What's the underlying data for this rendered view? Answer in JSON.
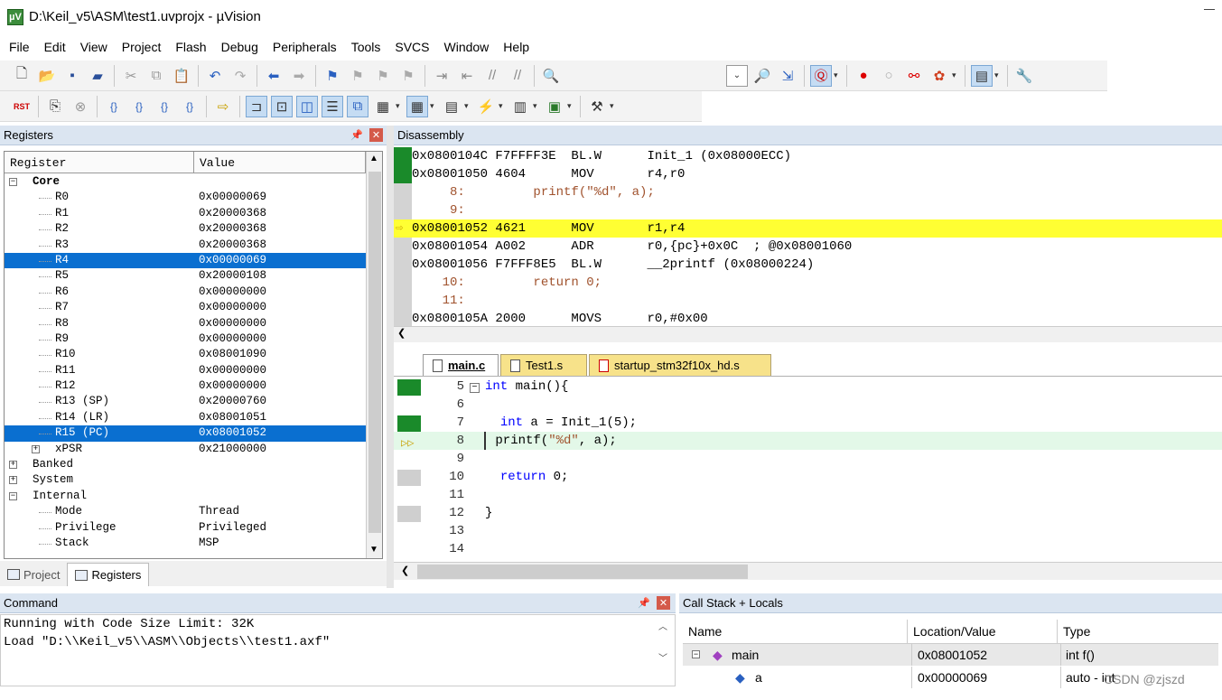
{
  "title": "D:\\Keil_v5\\ASM\\test1.uvprojx - µVision",
  "app_icon": "µV",
  "menu": [
    "File",
    "Edit",
    "View",
    "Project",
    "Flash",
    "Debug",
    "Peripherals",
    "Tools",
    "SVCS",
    "Window",
    "Help"
  ],
  "registers": {
    "header": "Registers",
    "col_register": "Register",
    "col_value": "Value",
    "rows": [
      {
        "name": "Core",
        "value": "",
        "level": 0,
        "expand": "−",
        "bold": true
      },
      {
        "name": "R0",
        "value": "0x00000069",
        "level": 1
      },
      {
        "name": "R1",
        "value": "0x20000368",
        "level": 1
      },
      {
        "name": "R2",
        "value": "0x20000368",
        "level": 1
      },
      {
        "name": "R3",
        "value": "0x20000368",
        "level": 1
      },
      {
        "name": "R4",
        "value": "0x00000069",
        "level": 1,
        "sel": true
      },
      {
        "name": "R5",
        "value": "0x20000108",
        "level": 1
      },
      {
        "name": "R6",
        "value": "0x00000000",
        "level": 1
      },
      {
        "name": "R7",
        "value": "0x00000000",
        "level": 1
      },
      {
        "name": "R8",
        "value": "0x00000000",
        "level": 1
      },
      {
        "name": "R9",
        "value": "0x00000000",
        "level": 1
      },
      {
        "name": "R10",
        "value": "0x08001090",
        "level": 1
      },
      {
        "name": "R11",
        "value": "0x00000000",
        "level": 1
      },
      {
        "name": "R12",
        "value": "0x00000000",
        "level": 1
      },
      {
        "name": "R13 (SP)",
        "value": "0x20000760",
        "level": 1
      },
      {
        "name": "R14 (LR)",
        "value": "0x08001051",
        "level": 1
      },
      {
        "name": "R15 (PC)",
        "value": "0x08001052",
        "level": 1,
        "sel": true
      },
      {
        "name": "xPSR",
        "value": "0x21000000",
        "level": 1,
        "expand": "+"
      },
      {
        "name": "Banked",
        "value": "",
        "level": 0,
        "expand": "+"
      },
      {
        "name": "System",
        "value": "",
        "level": 0,
        "expand": "+"
      },
      {
        "name": "Internal",
        "value": "",
        "level": 0,
        "expand": "−"
      },
      {
        "name": "Mode",
        "value": "Thread",
        "level": 1
      },
      {
        "name": "Privilege",
        "value": "Privileged",
        "level": 1
      },
      {
        "name": "Stack",
        "value": "MSP",
        "level": 1
      }
    ]
  },
  "left_tabs": {
    "project": "Project",
    "registers": "Registers"
  },
  "disassembly": {
    "header": "Disassembly",
    "lines": [
      {
        "text": "0x0800104C F7FFFF3E  BL.W      Init_1 (0x08000ECC)",
        "kind": "asm",
        "gutter": "g"
      },
      {
        "text": "0x08001050 4604      MOV       r4,r0",
        "kind": "asm",
        "gutter": "g"
      },
      {
        "text": "     8:         printf(\"%d\", a);",
        "kind": "src",
        "gutter": ""
      },
      {
        "text": "     9:",
        "kind": "src",
        "gutter": ""
      },
      {
        "text": "0x08001052 4621      MOV       r1,r4",
        "kind": "asm",
        "gutter": "cur"
      },
      {
        "text": "0x08001054 A002      ADR       r0,{pc}+0x0C  ; @0x08001060",
        "kind": "asm",
        "gutter": ""
      },
      {
        "text": "0x08001056 F7FFF8E5  BL.W      __2printf (0x08000224)",
        "kind": "asm",
        "gutter": ""
      },
      {
        "text": "    10:         return 0;",
        "kind": "src",
        "gutter": ""
      },
      {
        "text": "    11:",
        "kind": "src",
        "gutter": ""
      },
      {
        "text": "0x0800105A 2000      MOVS      r0,#0x00",
        "kind": "asm",
        "gutter": ""
      }
    ]
  },
  "file_tabs": {
    "main": "main.c",
    "test1": "Test1.s",
    "startup": "startup_stm32f10x_hd.s"
  },
  "editor": {
    "lines": [
      {
        "n": "5",
        "fold": "−",
        "gutter": "g",
        "tokens": [
          {
            "t": "int",
            "c": "kw"
          },
          {
            "t": " main(){",
            "c": ""
          }
        ]
      },
      {
        "n": "6",
        "gutter": "none",
        "tokens": []
      },
      {
        "n": "7",
        "gutter": "g",
        "tokens": [
          {
            "t": "  ",
            "c": ""
          },
          {
            "t": "int",
            "c": "kw"
          },
          {
            "t": " a = Init_1(5);",
            "c": ""
          }
        ]
      },
      {
        "n": "8",
        "gutter": "cur",
        "tokens": [
          {
            "t": " printf(",
            "c": ""
          },
          {
            "t": "\"%d\"",
            "c": "str"
          },
          {
            "t": ", a);",
            "c": ""
          }
        ]
      },
      {
        "n": "9",
        "gutter": "none",
        "tokens": []
      },
      {
        "n": "10",
        "gutter": "gray",
        "tokens": [
          {
            "t": "  ",
            "c": ""
          },
          {
            "t": "return",
            "c": "kw"
          },
          {
            "t": " 0;",
            "c": ""
          }
        ]
      },
      {
        "n": "11",
        "gutter": "none",
        "tokens": []
      },
      {
        "n": "12",
        "gutter": "gray",
        "tokens": [
          {
            "t": "}",
            "c": ""
          }
        ]
      },
      {
        "n": "13",
        "gutter": "none",
        "tokens": []
      },
      {
        "n": "14",
        "gutter": "none",
        "tokens": []
      }
    ]
  },
  "command": {
    "header": "Command",
    "lines": [
      "Running with Code Size Limit: 32K",
      "Load \"D:\\\\Keil_v5\\\\ASM\\\\Objects\\\\test1.axf\""
    ]
  },
  "callstack": {
    "header": "Call Stack + Locals",
    "col_name": "Name",
    "col_location": "Location/Value",
    "col_type": "Type",
    "rows": [
      {
        "name": "main",
        "location": "0x08001052",
        "type": "int f()"
      },
      {
        "name": "a",
        "location": "0x00000069",
        "type": "auto - int"
      }
    ]
  },
  "watermark": "CSDN @zjszd",
  "icons": {
    "toolbar1": [
      "new-file-icon",
      "open-icon",
      "save-icon",
      "save-all-icon",
      "cut-icon",
      "copy-icon",
      "paste-icon",
      "undo-icon",
      "redo-icon",
      "back-icon",
      "forward-icon",
      "bookmark-icon",
      "prev-bookmark-icon",
      "next-bookmark-icon",
      "clear-bookmarks-icon",
      "indent-icon",
      "unindent-icon",
      "comment-icon",
      "uncomment-icon",
      "find-in-files-icon",
      "target-dropdown-icon",
      "rebuild-icon",
      "download-icon",
      "debug-icon",
      "breakpoint-icon",
      "disable-breakpoint-icon",
      "kill-breakpoints-icon",
      "enable-all-icon",
      "window-layout-icon",
      "configure-icon"
    ],
    "toolbar2": [
      "reset-icon",
      "run-icon",
      "stop-icon",
      "step-icon",
      "step-over-icon",
      "step-out-icon",
      "run-to-cursor-icon",
      "show-next-statement-icon",
      "command-window-icon",
      "disassembly-window-icon",
      "symbols-window-icon",
      "registers-window-icon",
      "call-stack-window-icon",
      "watch-window-icon",
      "memory-window-icon",
      "serial-window-icon",
      "analysis-window-icon",
      "trace-window-icon",
      "system-viewer-icon",
      "toolbox-icon"
    ]
  }
}
